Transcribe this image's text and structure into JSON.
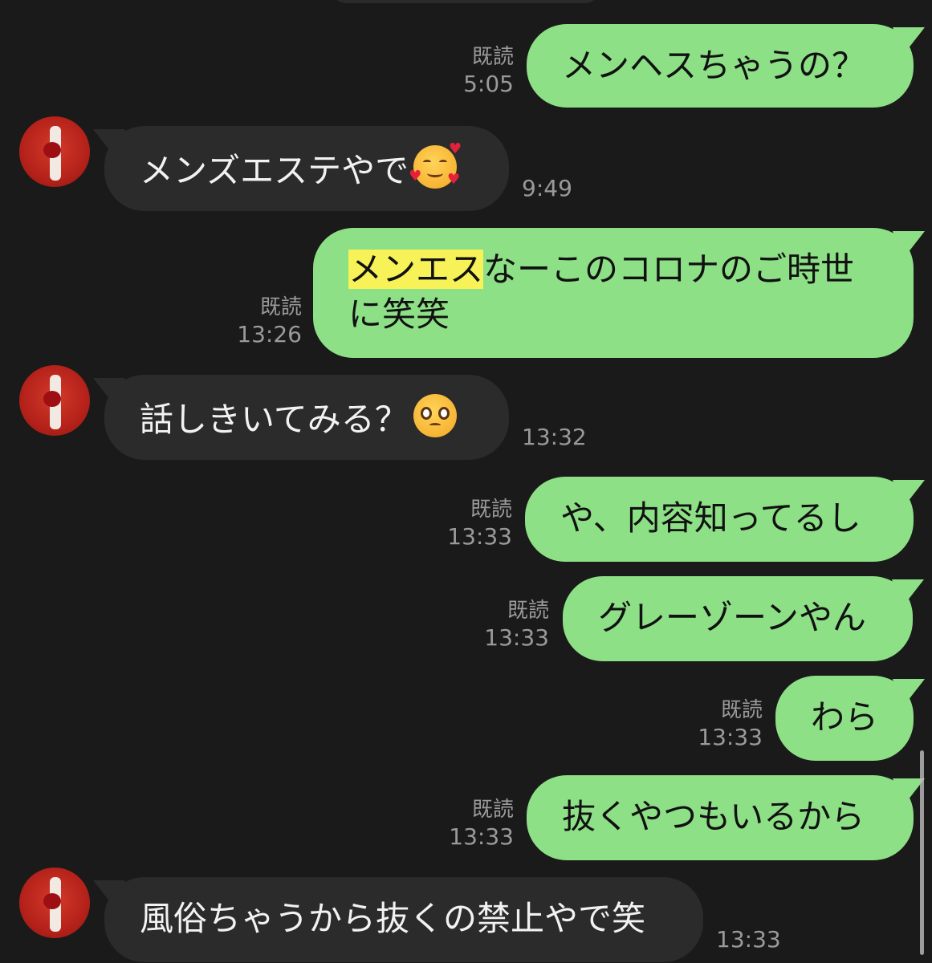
{
  "messages": [
    {
      "dir": "out",
      "text": "メンヘスちゃうの？",
      "read": "既読",
      "time": "5:05"
    },
    {
      "dir": "in",
      "text": "メンズエステやで",
      "emoji": "smiling-face-with-hearts",
      "time": "9:49"
    },
    {
      "dir": "out",
      "highlight": "メンエス",
      "text_line1": "なーこのコロナのご時世",
      "text_line2": "に笑笑",
      "read": "既読",
      "time": "13:26"
    },
    {
      "dir": "in",
      "text": "話しきいてみる？",
      "emoji": "pleading-face",
      "time": "13:32"
    },
    {
      "dir": "out",
      "text": "や、内容知ってるし",
      "read": "既読",
      "time": "13:33"
    },
    {
      "dir": "out",
      "text": "グレーゾーンやん",
      "read": "既読",
      "time": "13:33"
    },
    {
      "dir": "out",
      "text": "わら",
      "read": "既読",
      "time": "13:33"
    },
    {
      "dir": "out",
      "text": "抜くやつもいるから",
      "read": "既読",
      "time": "13:33"
    },
    {
      "dir": "in",
      "text": "風俗ちゃうから抜くの禁止やで笑",
      "time": "13:33"
    }
  ],
  "colors": {
    "background": "#1a1a1a",
    "outgoing_bubble": "#8de086",
    "incoming_bubble": "#2b2b2b",
    "highlight": "#f7f257",
    "meta_text": "#9a9a9a"
  }
}
